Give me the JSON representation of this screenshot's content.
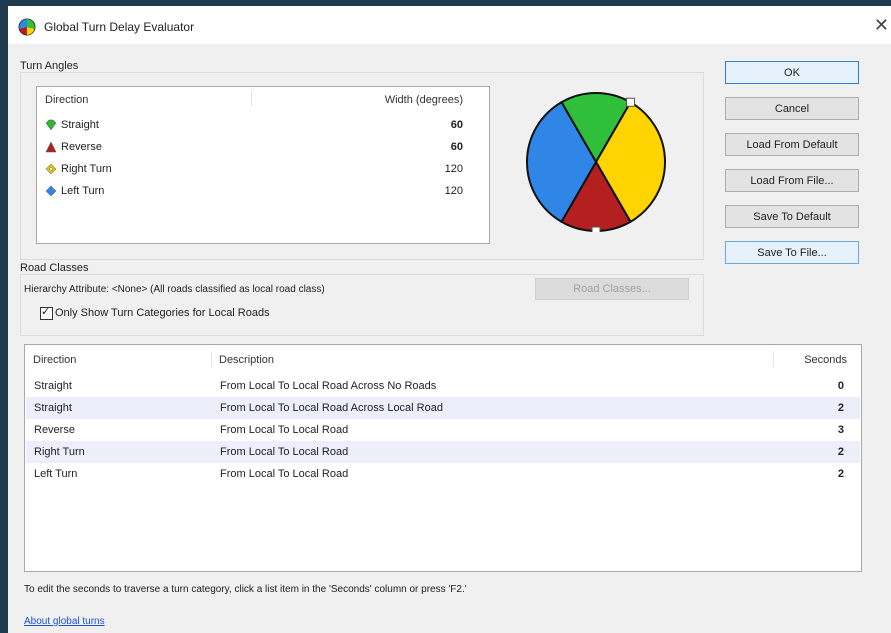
{
  "window": {
    "title": "Global Turn Delay Evaluator",
    "close_glyph": "✕"
  },
  "turn_angles": {
    "label": "Turn Angles",
    "headers": {
      "direction": "Direction",
      "width": "Width (degrees)"
    },
    "rows": [
      {
        "icon": "green-diamond-icon",
        "color": "#2fb52f",
        "name": "Straight",
        "width": "60"
      },
      {
        "icon": "red-triangle-icon",
        "color": "#b02020",
        "name": "Reverse",
        "width": "60"
      },
      {
        "icon": "yellow-arrow-icon",
        "color": "#e8c000",
        "name": "Right Turn",
        "width": "120"
      },
      {
        "icon": "blue-arrow-icon",
        "color": "#2f86e6",
        "name": "Left Turn",
        "width": "120"
      }
    ]
  },
  "pie": {
    "slices": [
      {
        "name": "Straight",
        "degrees": 60,
        "color": "#2fbf3a"
      },
      {
        "name": "Right Turn",
        "degrees": 120,
        "color": "#ffd400"
      },
      {
        "name": "Reverse",
        "degrees": 60,
        "color": "#b41f1f"
      },
      {
        "name": "Left Turn",
        "degrees": 120,
        "color": "#2f86e6"
      }
    ]
  },
  "buttons": {
    "ok": "OK",
    "cancel": "Cancel",
    "load_default": "Load From Default",
    "load_file": "Load From File...",
    "save_default": "Save To Default",
    "save_file": "Save To File..."
  },
  "road_classes": {
    "label": "Road Classes",
    "hierarchy_text": "Hierarchy Attribute: <None> (All roads classified as local road class)",
    "button": "Road Classes...",
    "checkbox_label": "Only Show Turn Categories for Local Roads",
    "checkbox_checked": true,
    "check_glyph": "✓"
  },
  "turn_table": {
    "headers": {
      "direction": "Direction",
      "description": "Description",
      "seconds": "Seconds"
    },
    "rows": [
      {
        "direction": "Straight",
        "description": "From Local To Local Road Across No Roads",
        "seconds": "0"
      },
      {
        "direction": "Straight",
        "description": "From Local To Local Road Across Local Road",
        "seconds": "2"
      },
      {
        "direction": "Reverse",
        "description": "From Local To Local Road",
        "seconds": "3"
      },
      {
        "direction": "Right Turn",
        "description": "From Local To Local Road",
        "seconds": "2"
      },
      {
        "direction": "Left Turn",
        "description": "From Local To Local Road",
        "seconds": "2"
      }
    ]
  },
  "footer": {
    "note": "To edit the seconds to traverse a turn category, click a list item in the 'Seconds' column or press 'F2.'",
    "link": "About global turns"
  }
}
